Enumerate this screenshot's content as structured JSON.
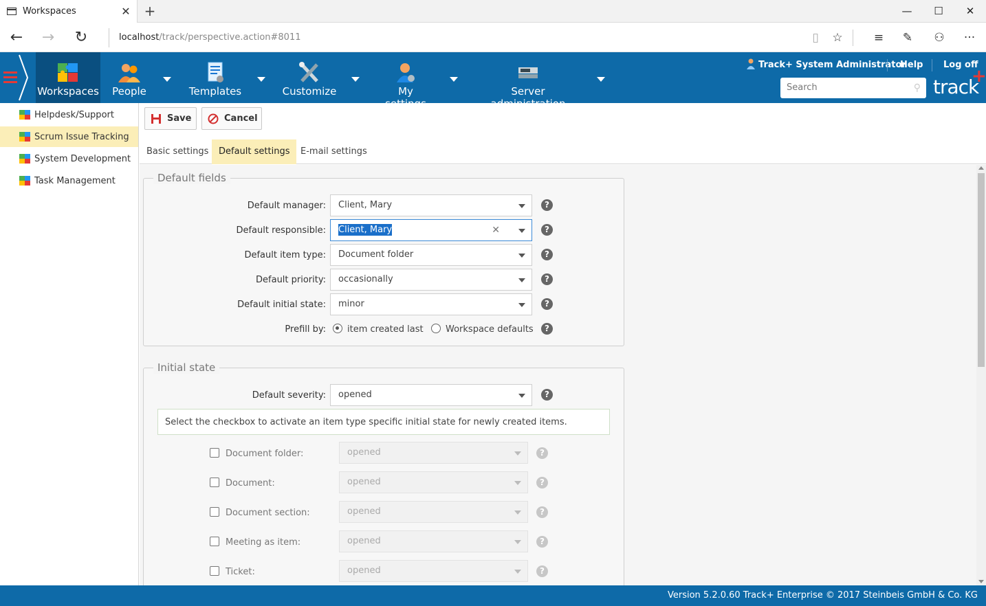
{
  "browser": {
    "tab_title": "Workspaces",
    "tab_close": "✕",
    "new_tab": "+",
    "url_host": "localhost",
    "url_path": "/track/perspective.action#8011",
    "win_min": "—",
    "win_max": "☐",
    "win_close": "✕"
  },
  "header": {
    "menu": [
      {
        "label": "Workspaces"
      },
      {
        "label": "People"
      },
      {
        "label": "Templates"
      },
      {
        "label": "Customize"
      },
      {
        "label": "My settings"
      },
      {
        "label": "Server administration"
      }
    ],
    "user": "Track+ System Administrator",
    "help": "Help",
    "logoff": "Log off",
    "search_placeholder": "Search",
    "logo": "track",
    "logo_plus": "+"
  },
  "sidebar": {
    "items": [
      {
        "label": "Helpdesk/Support"
      },
      {
        "label": "Scrum Issue Tracking"
      },
      {
        "label": "System Development"
      },
      {
        "label": "Task Management"
      }
    ]
  },
  "toolbar": {
    "save": "Save",
    "cancel": "Cancel"
  },
  "tabs": [
    {
      "label": "Basic settings"
    },
    {
      "label": "Default settings"
    },
    {
      "label": "E-mail settings"
    }
  ],
  "default_fields": {
    "legend": "Default fields",
    "manager_label": "Default manager:",
    "manager_value": "Client, Mary",
    "responsible_label": "Default responsible:",
    "responsible_value": "Client, Mary",
    "item_type_label": "Default item type:",
    "item_type_value": "Document folder",
    "priority_label": "Default priority:",
    "priority_value": "occasionally",
    "initial_state_label": "Default initial state:",
    "initial_state_value": "minor",
    "prefill_label": "Prefill by:",
    "prefill_opt1": "item created last",
    "prefill_opt2": "Workspace defaults"
  },
  "initial_state": {
    "legend": "Initial state",
    "severity_label": "Default severity:",
    "severity_value": "opened",
    "info": "Select the checkbox to activate an item type specific initial state for newly created items.",
    "rows": [
      {
        "label": "Document folder:",
        "value": "opened"
      },
      {
        "label": "Document:",
        "value": "opened"
      },
      {
        "label": "Document section:",
        "value": "opened"
      },
      {
        "label": "Meeting as item:",
        "value": "opened"
      },
      {
        "label": "Ticket:",
        "value": "opened"
      }
    ]
  },
  "help_glyph": "?",
  "footer": "Version 5.2.0.60 Track+ Enterprise   © 2017 Steinbeis GmbH & Co. KG",
  "colors": {
    "brand": "#0e6aa8",
    "active_tab": "#fbeeb8",
    "accent_red": "#e53935"
  }
}
